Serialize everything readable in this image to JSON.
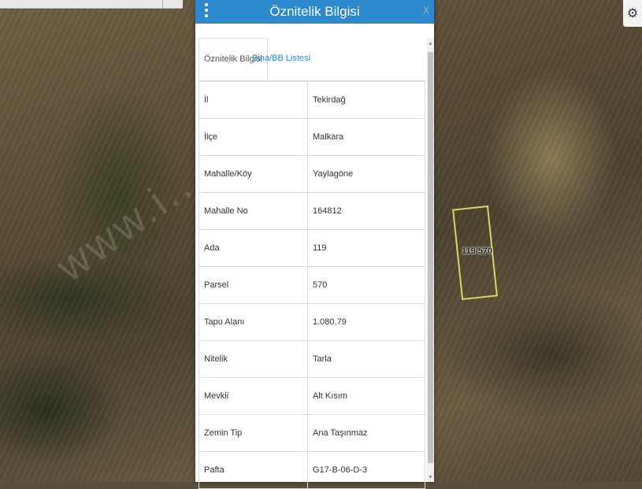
{
  "map": {
    "parcel_label": "119/570",
    "watermark": "www.i...a.net.tr",
    "settings_icon": "gear-icon"
  },
  "panel": {
    "title": "Öznitelik Bilgisi",
    "close_label": "x",
    "tabs": [
      {
        "label": "Öznitelik Bilgisi",
        "active": true
      },
      {
        "label": "Bina/BB Listesi",
        "active": false
      }
    ],
    "rows": [
      {
        "key": "İl",
        "value": "Tekirdağ"
      },
      {
        "key": "İlçe",
        "value": "Malkara"
      },
      {
        "key": "Mahalle/Köy",
        "value": "Yaylagöne"
      },
      {
        "key": "Mahalle No",
        "value": "164812"
      },
      {
        "key": "Ada",
        "value": "119"
      },
      {
        "key": "Parsel",
        "value": "570"
      },
      {
        "key": "Tapu Alanı",
        "value": "1.080,79"
      },
      {
        "key": "Nitelik",
        "value": "Tarla"
      },
      {
        "key": "Mevkii",
        "value": "Alt Kısım"
      },
      {
        "key": "Zemin Tip",
        "value": "Ana Taşınmaz"
      },
      {
        "key": "Pafta",
        "value": "G17-B-06-D-3"
      }
    ]
  },
  "colors": {
    "header_blue": "#2d88cc",
    "parcel_outline": "#d9d36a"
  }
}
